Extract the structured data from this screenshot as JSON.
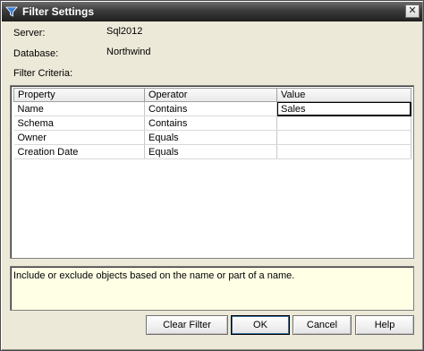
{
  "window": {
    "title": "Filter Settings",
    "close_glyph": "✕"
  },
  "info": {
    "server_label": "Server:",
    "server_value": "Sql2012",
    "database_label": "Database:",
    "database_value": "Northwind",
    "criteria_label": "Filter Criteria:"
  },
  "grid": {
    "columns": [
      "Property",
      "Operator",
      "Value"
    ],
    "rows": [
      {
        "property": "Name",
        "operator": "Contains",
        "value": "Sales"
      },
      {
        "property": "Schema",
        "operator": "Contains",
        "value": ""
      },
      {
        "property": "Owner",
        "operator": "Equals",
        "value": ""
      },
      {
        "property": "Creation Date",
        "operator": "Equals",
        "value": ""
      }
    ]
  },
  "description": "Include or exclude objects based on the name or part of a name.",
  "buttons": {
    "clear_filter": "Clear Filter",
    "ok": "OK",
    "cancel": "Cancel",
    "help": "Help"
  },
  "icons": {
    "title_icon": "funnel-icon",
    "close_icon": "close-icon"
  }
}
